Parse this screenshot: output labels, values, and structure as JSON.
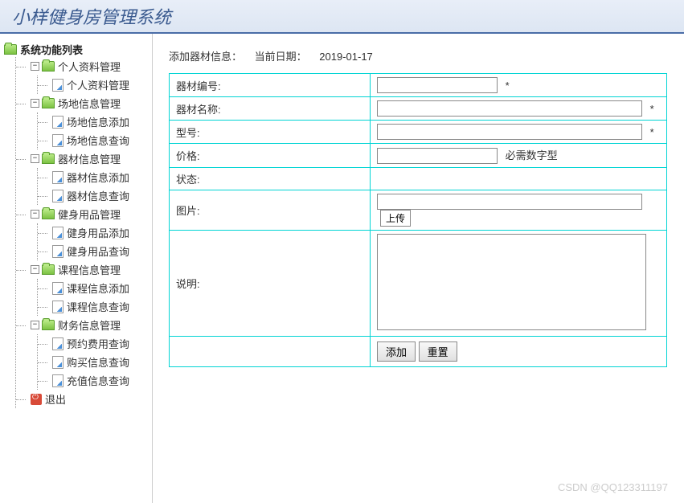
{
  "header": {
    "title": "小样健身房管理系统"
  },
  "sidebar": {
    "root": "系统功能列表",
    "groups": [
      {
        "label": "个人资料管理",
        "items": [
          "个人资料管理"
        ]
      },
      {
        "label": "场地信息管理",
        "items": [
          "场地信息添加",
          "场地信息查询"
        ]
      },
      {
        "label": "器材信息管理",
        "items": [
          "器材信息添加",
          "器材信息查询"
        ]
      },
      {
        "label": "健身用品管理",
        "items": [
          "健身用品添加",
          "健身用品查询"
        ]
      },
      {
        "label": "课程信息管理",
        "items": [
          "课程信息添加",
          "课程信息查询"
        ]
      },
      {
        "label": "财务信息管理",
        "items": [
          "预约费用查询",
          "购买信息查询",
          "充值信息查询"
        ]
      }
    ],
    "exit": "退出"
  },
  "main": {
    "info_prefix": "添加器材信息：",
    "date_label": "当前日期：",
    "date_value": "2019-01-17",
    "fields": {
      "equip_no": {
        "label": "器材编号:",
        "value": "",
        "hint": "*"
      },
      "equip_name": {
        "label": "器材名称:",
        "value": "",
        "hint": "*"
      },
      "model": {
        "label": "型号:",
        "value": "",
        "hint": "*"
      },
      "price": {
        "label": "价格:",
        "value": "",
        "hint": "必需数字型"
      },
      "status": {
        "label": "状态:",
        "value": ""
      },
      "image": {
        "label": "图片:",
        "value": "",
        "upload": "上传"
      },
      "desc": {
        "label": "说明:",
        "value": ""
      }
    },
    "buttons": {
      "add": "添加",
      "reset": "重置"
    }
  },
  "watermark": "CSDN @QQ123311197"
}
